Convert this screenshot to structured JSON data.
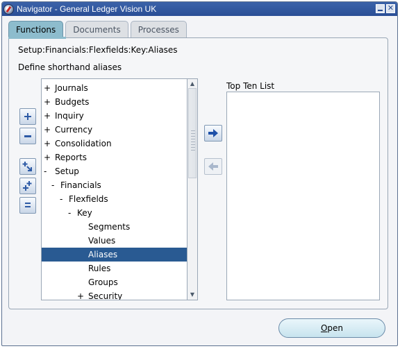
{
  "window": {
    "title": "Navigator - General Ledger Vision UK",
    "app_icon": "oracle-navigator-icon",
    "controls": [
      "minimize-icon",
      "close-icon"
    ]
  },
  "tabs": [
    {
      "label": "Functions",
      "active": true
    },
    {
      "label": "Documents",
      "active": false
    },
    {
      "label": "Processes",
      "active": false
    }
  ],
  "breadcrumb": "Setup:Financials:Flexfields:Key:Aliases",
  "instruction": "Define shorthand aliases",
  "tree": {
    "items": [
      {
        "sign": "+",
        "label": "Journals",
        "depth": 0
      },
      {
        "sign": "+",
        "label": "Budgets",
        "depth": 0
      },
      {
        "sign": "+",
        "label": "Inquiry",
        "depth": 0
      },
      {
        "sign": "+",
        "label": "Currency",
        "depth": 0
      },
      {
        "sign": "+",
        "label": "Consolidation",
        "depth": 0
      },
      {
        "sign": "+",
        "label": "Reports",
        "depth": 0
      },
      {
        "sign": "-",
        "label": "Setup",
        "depth": 0
      },
      {
        "sign": "-",
        "label": "Financials",
        "depth": 1
      },
      {
        "sign": "-",
        "label": "Flexfields",
        "depth": 2
      },
      {
        "sign": "-",
        "label": "Key",
        "depth": 3
      },
      {
        "sign": "",
        "label": "Segments",
        "depth": 4
      },
      {
        "sign": "",
        "label": "Values",
        "depth": 4
      },
      {
        "sign": "",
        "label": "Aliases",
        "depth": 4,
        "selected": true
      },
      {
        "sign": "",
        "label": "Rules",
        "depth": 4
      },
      {
        "sign": "",
        "label": "Groups",
        "depth": 4
      },
      {
        "sign": "+",
        "label": "Security",
        "depth": 4
      }
    ]
  },
  "tree_controls": [
    "expand-icon",
    "collapse-icon",
    "expand-branch-icon",
    "expand-all-icon",
    "collapse-all-icon"
  ],
  "top_ten": {
    "label": "Top Ten List",
    "items": []
  },
  "buttons": {
    "open_label": "Open",
    "open_mnemonic": "O",
    "open_rest": "pen"
  },
  "colors": {
    "title_bar": "#2f56a0",
    "active_tab": "#8dbccd",
    "selection": "#295a92"
  }
}
